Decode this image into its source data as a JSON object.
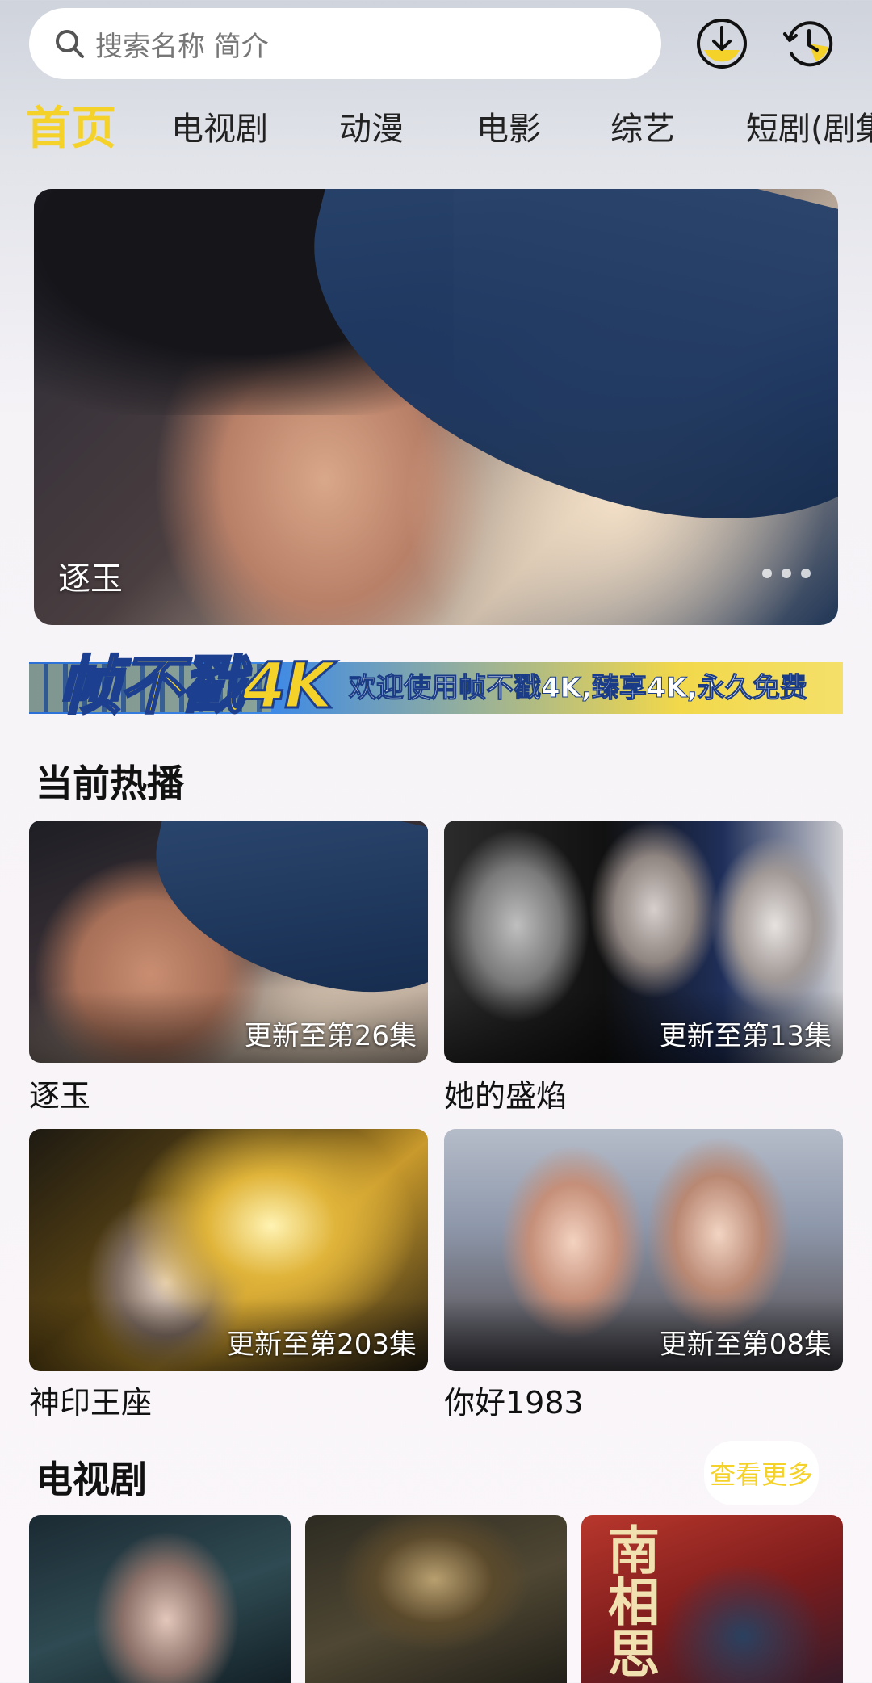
{
  "search": {
    "placeholder": "搜索名称 简介"
  },
  "header_icons": [
    "download-icon",
    "history-icon"
  ],
  "tabs": [
    {
      "label": "首页",
      "active": true
    },
    {
      "label": "电视剧"
    },
    {
      "label": "动漫"
    },
    {
      "label": "电影"
    },
    {
      "label": "综艺"
    },
    {
      "label": "短剧(剧集"
    }
  ],
  "banner": {
    "title": "逐玉",
    "pager": "•••"
  },
  "promo": {
    "logo": "帧不戳4K",
    "text": "欢迎使用帧不戳4K,臻享4K,永久免费"
  },
  "hot": {
    "title": "当前热播",
    "items": [
      {
        "title": "逐玉",
        "badge": "更新至第26集"
      },
      {
        "title": "她的盛焰",
        "badge": "更新至第13集"
      },
      {
        "title": "神印王座",
        "badge": "更新至第203集"
      },
      {
        "title": "你好1983",
        "badge": "更新至第08集"
      }
    ]
  },
  "tv": {
    "title": "电视剧",
    "more": "查看更多",
    "poster3_text": "南相思"
  },
  "colors": {
    "accent": "#f5d22a",
    "text": "#111111"
  }
}
